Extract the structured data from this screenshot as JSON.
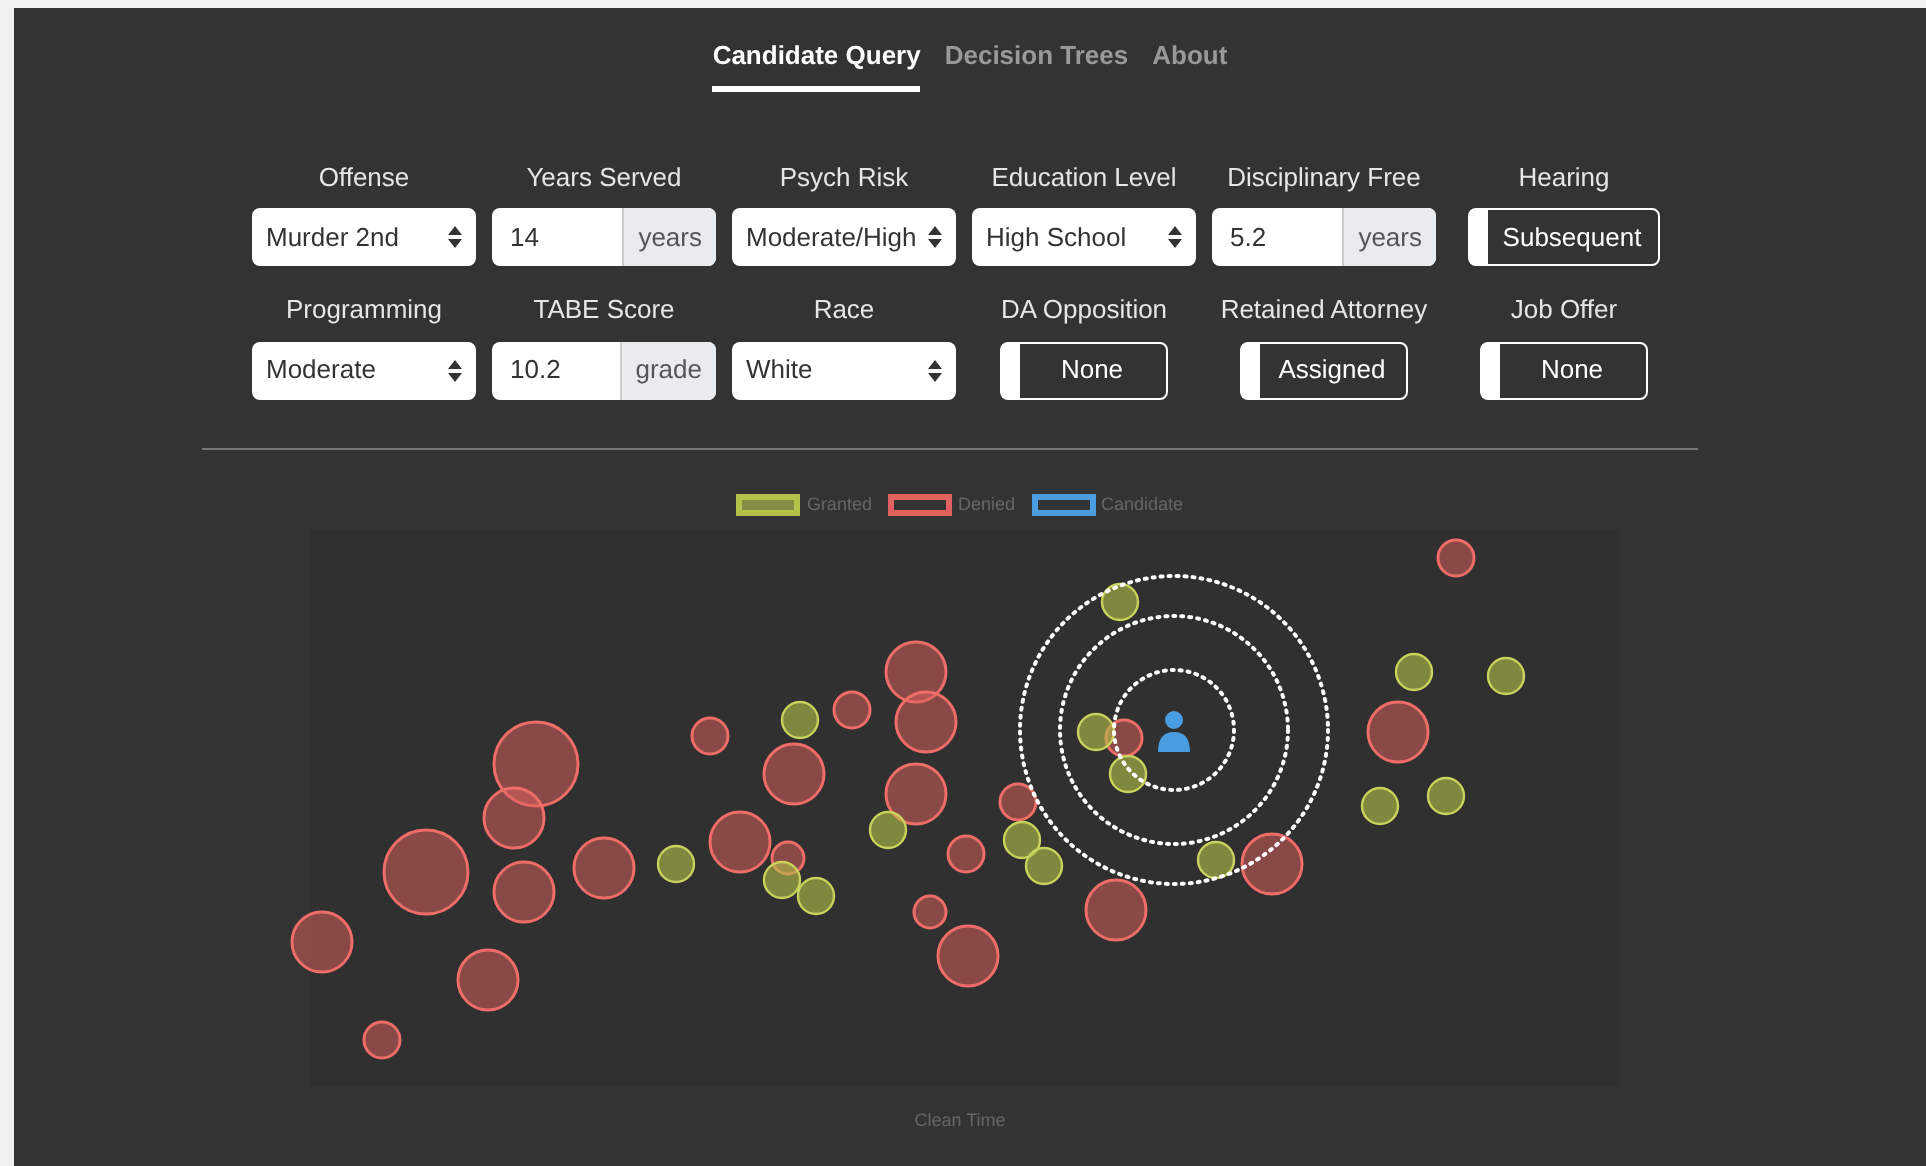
{
  "tabs": [
    {
      "label": "Candidate Query",
      "selected": true
    },
    {
      "label": "Decision Trees",
      "selected": false
    },
    {
      "label": "About",
      "selected": false
    }
  ],
  "form_rows": [
    [
      {
        "label": "Offense",
        "kind": "select",
        "value": "Murder 2nd"
      },
      {
        "label": "Years Served",
        "kind": "addon",
        "value": "14",
        "addon": "years"
      },
      {
        "label": "Psych Risk",
        "kind": "select",
        "value": "Moderate/High"
      },
      {
        "label": "Education Level",
        "kind": "select",
        "value": "High School"
      },
      {
        "label": "Disciplinary Free",
        "kind": "addon",
        "value": "5.2",
        "addon": "years"
      },
      {
        "label": "Hearing",
        "kind": "toggle",
        "value": "Subsequent",
        "on": false
      }
    ],
    [
      {
        "label": "Programming",
        "kind": "select",
        "value": "Moderate"
      },
      {
        "label": "TABE Score",
        "kind": "addon",
        "value": "10.2",
        "addon": "grade"
      },
      {
        "label": "Race",
        "kind": "select",
        "value": "White"
      },
      {
        "label": "DA Opposition",
        "kind": "toggle",
        "value": "None",
        "on": false
      },
      {
        "label": "Retained Attorney",
        "kind": "toggle",
        "value": "Assigned",
        "on": false
      },
      {
        "label": "Job Offer",
        "kind": "toggle",
        "value": "None",
        "on": false
      }
    ]
  ],
  "chart": {
    "legend": [
      {
        "label": "Granted",
        "color": "#b5c24a"
      },
      {
        "label": "Denied",
        "color": "#e0615e"
      },
      {
        "label": "Candidate",
        "color": "#4a9de0"
      }
    ],
    "xlabel": "Clean Time"
  }
}
